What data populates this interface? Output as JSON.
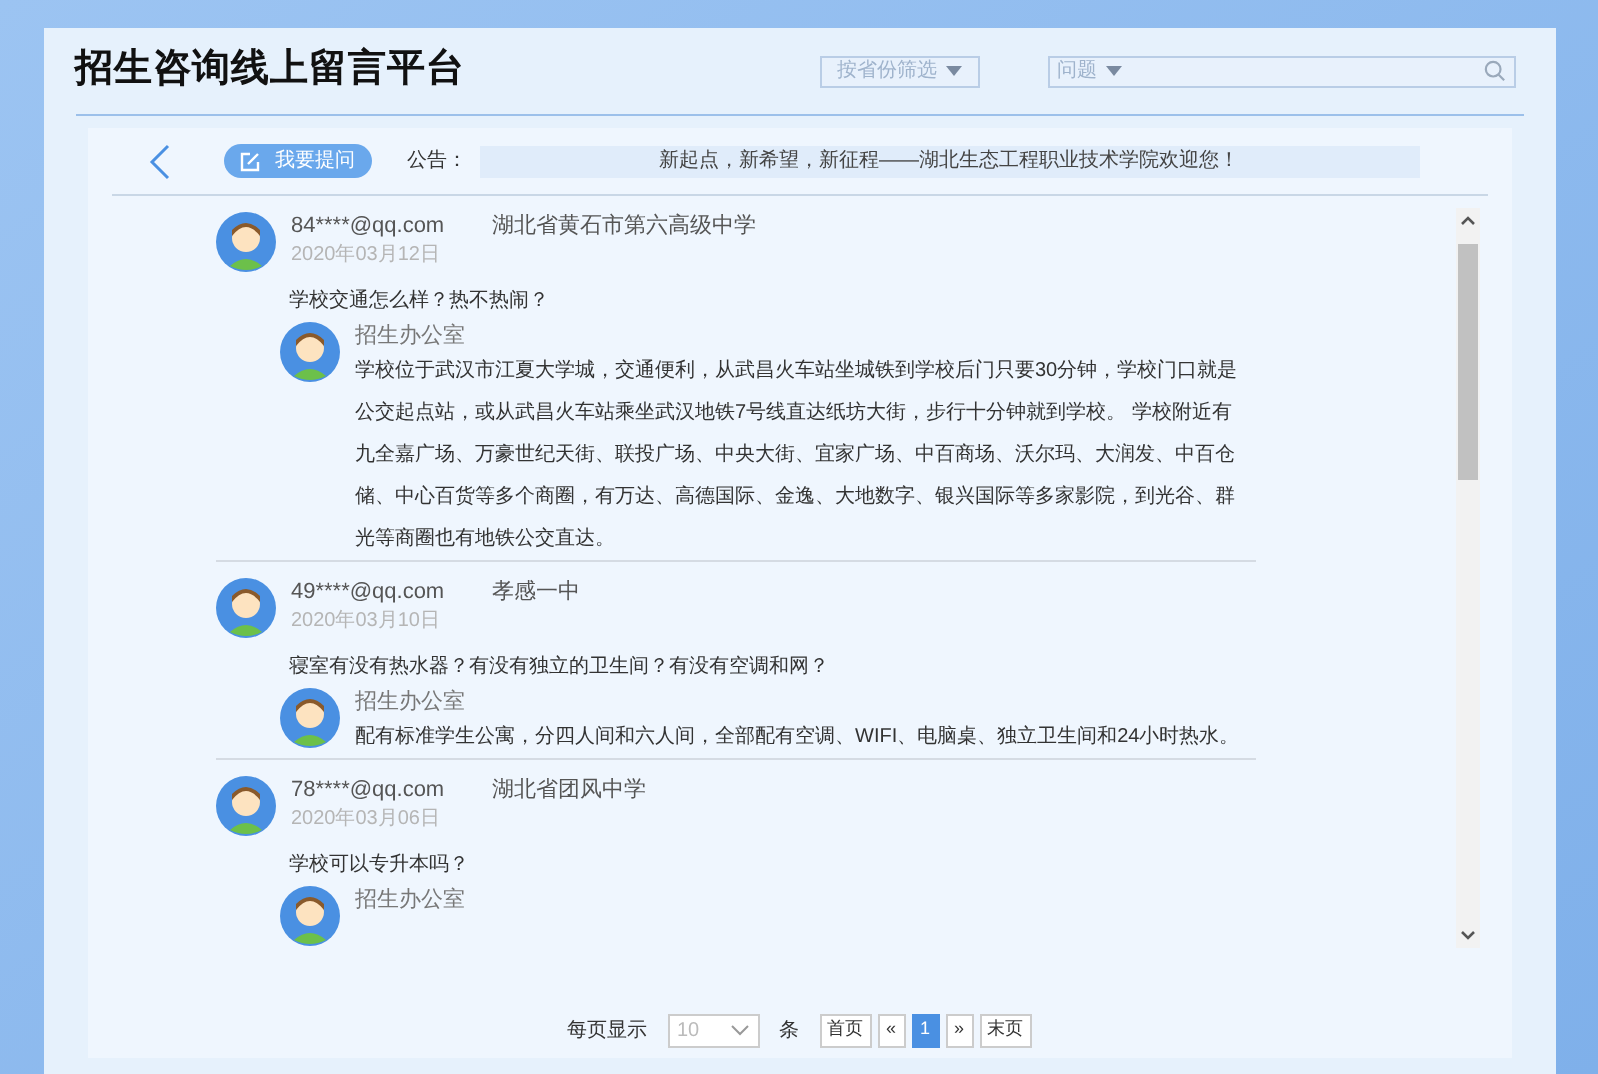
{
  "header": {
    "title": "招生咨询线上留言平台",
    "filters": [
      {
        "kind": "dropdown",
        "label": "按省份筛选"
      },
      {
        "kind": "search",
        "label": "问题"
      }
    ]
  },
  "toolbar": {
    "ask_button": "我要提问",
    "notice_label": "公告：",
    "notice_text": "新起点，新希望，新征程——湖北生态工程职业技术学院欢迎您！"
  },
  "messages": [
    {
      "user": "84****@qq.com",
      "school": "湖北省黄石市第六高级中学",
      "date": "2020年03月12日",
      "question": "学校交通怎么样？热不热闹？",
      "reply": {
        "author": "招生办公室",
        "text": "学校位于武汉市江夏大学城，交通便利，从武昌火车站坐城铁到学校后门只要30分钟，学校门口就是公交起点站，或从武昌火车站乘坐武汉地铁7号线直达纸坊大街，步行十分钟就到学校。 学校附近有九全嘉广场、万豪世纪天街、联投广场、中央大街、宜家广场、中百商场、沃尔玛、大润发、中百仓储、中心百货等多个商圈，有万达、高德国际、金逸、大地数字、银兴国际等多家影院，到光谷、群光等商圈也有地铁公交直达。"
      }
    },
    {
      "user": "49****@qq.com",
      "school": "孝感一中",
      "date": "2020年03月10日",
      "question": "寝室有没有热水器？有没有独立的卫生间？有没有空调和网？",
      "reply": {
        "author": "招生办公室",
        "text": "配有标准学生公寓，分四人间和六人间，全部配有空调、WIFI、电脑桌、独立卫生间和24小时热水。"
      }
    },
    {
      "user": "78****@qq.com",
      "school": "湖北省团风中学",
      "date": "2020年03月06日",
      "question": "学校可以专升本吗？",
      "reply": {
        "author": "招生办公室"
      }
    }
  ],
  "pagination": {
    "per_page_label": "每页显示",
    "per_page_value": "10",
    "unit": "条",
    "buttons": [
      {
        "label": "首页",
        "selected": false
      },
      {
        "label": "«",
        "selected": false
      },
      {
        "label": "1",
        "selected": true
      },
      {
        "label": "»",
        "selected": false
      },
      {
        "label": "末页",
        "selected": false
      }
    ]
  }
}
